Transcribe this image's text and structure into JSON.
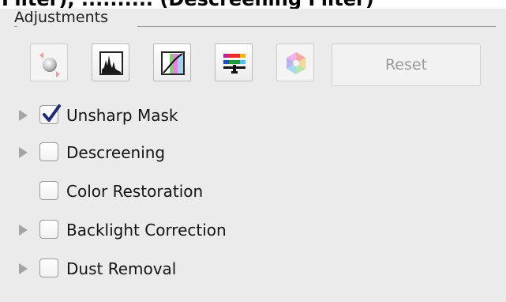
{
  "page_header": {
    "cut_title": "Filter), .......... (Descreening Filter)"
  },
  "adjustments": {
    "group_title": "Adjustments",
    "toolbar": {
      "buttons": [
        {
          "icon": "auto-adjust-icon",
          "enabled": false
        },
        {
          "icon": "histogram-icon",
          "enabled": true
        },
        {
          "icon": "tone-curve-icon",
          "enabled": true
        },
        {
          "icon": "color-balance-icon",
          "enabled": true
        },
        {
          "icon": "color-wheel-icon",
          "enabled": false
        }
      ],
      "reset_label": "Reset",
      "reset_enabled": false
    },
    "options": [
      {
        "label": "Unsharp Mask",
        "checked": true,
        "expandable": true
      },
      {
        "label": "Descreening",
        "checked": false,
        "expandable": true
      },
      {
        "label": "Color Restoration",
        "checked": false,
        "expandable": false
      },
      {
        "label": "Backlight Correction",
        "checked": false,
        "expandable": true
      },
      {
        "label": "Dust Removal",
        "checked": false,
        "expandable": true
      }
    ]
  }
}
